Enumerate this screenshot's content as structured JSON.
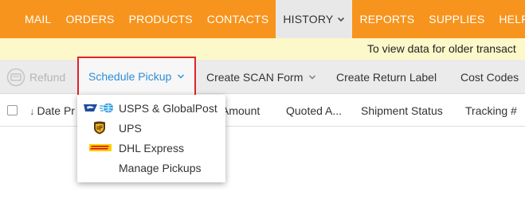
{
  "nav": {
    "items": [
      "MAIL",
      "ORDERS",
      "PRODUCTS",
      "CONTACTS",
      "HISTORY",
      "REPORTS",
      "SUPPLIES",
      "HELP"
    ],
    "active": "HISTORY"
  },
  "banner": {
    "text": "To view data for older transact"
  },
  "toolbar": {
    "refund": "Refund",
    "schedule_pickup": "Schedule Pickup",
    "create_scan_form": "Create SCAN Form",
    "create_return_label": "Create Return Label",
    "cost_codes": "Cost Codes"
  },
  "table": {
    "columns": [
      "Date Pr",
      "Amount",
      "Quoted A...",
      "Shipment Status",
      "Tracking #"
    ]
  },
  "dropdown": {
    "items": [
      "USPS & GlobalPost",
      "UPS",
      "DHL Express",
      "Manage Pickups"
    ]
  },
  "colors": {
    "nav_bg": "#f7941d",
    "banner_bg": "#fdf8c9",
    "link_blue": "#2c8ed6",
    "highlight_red": "#e0232b"
  }
}
